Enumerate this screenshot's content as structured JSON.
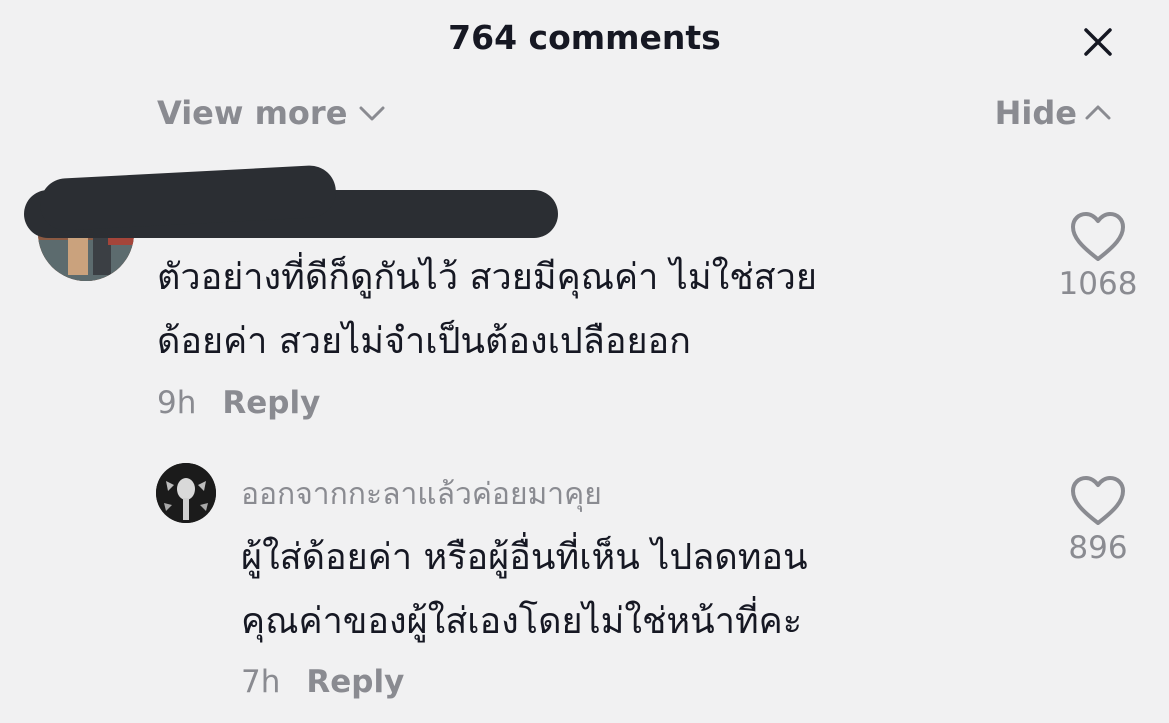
{
  "header": {
    "title": "764 comments"
  },
  "controls": {
    "view_more": "View more",
    "hide": "Hide"
  },
  "comment": {
    "lines": [
      "ตัวอย่างที่ดีก็ดูกันไว้ สวยมีคุณค่า ไม่ใช่สวย",
      "ด้อยค่า สวยไม่จำเป็นต้องเปลือยอก"
    ],
    "time": "9h",
    "reply_label": "Reply",
    "likes": "1068"
  },
  "reply": {
    "username": "ออกจากกะลาแล้วค่อยมาคุย",
    "lines": [
      "ผู้ใส่ด้อยค่า หรือผู้อื่นที่เห็น ไปลดทอน",
      "คุณค่าของผู้ใส่เองโดยไม่ใช่หน้าที่คะ"
    ],
    "time": "7h",
    "reply_label": "Reply",
    "likes": "896"
  },
  "icons": {
    "close": "close-icon",
    "view_more": "chevron-down-icon",
    "hide": "chevron-up-icon",
    "like": "heart-outline-icon"
  },
  "colors": {
    "text": "#161823",
    "muted": "#8a8b91",
    "background": "#f1f1f2",
    "redaction": "#2b2e33"
  }
}
